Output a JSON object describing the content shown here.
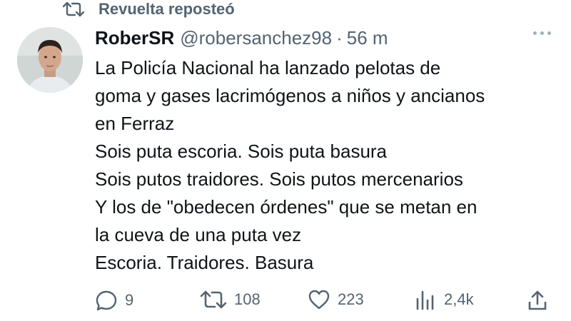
{
  "repost": {
    "icon": "repost-icon",
    "label": "Revuelta reposteó"
  },
  "author": {
    "name": "RoberSR",
    "handle": "@robersanchez98",
    "separator": "·",
    "time": "56 m"
  },
  "tweet_lines": [
    "La Policía Nacional ha lanzado pelotas de",
    "goma y gases lacrimógenos a niños y ancianos",
    "en Ferraz",
    "Sois puta escoria. Sois puta basura",
    "Sois putos traidores. Sois putos mercenarios",
    "Y los de \"obedecen órdenes\" que se metan en",
    "la cueva de una puta vez",
    "Escoria. Traidores. Basura"
  ],
  "actions": {
    "replies": "9",
    "reposts": "108",
    "likes": "223",
    "views": "2,4k"
  },
  "colors": {
    "text": "#0f1419",
    "secondary": "#536471"
  }
}
